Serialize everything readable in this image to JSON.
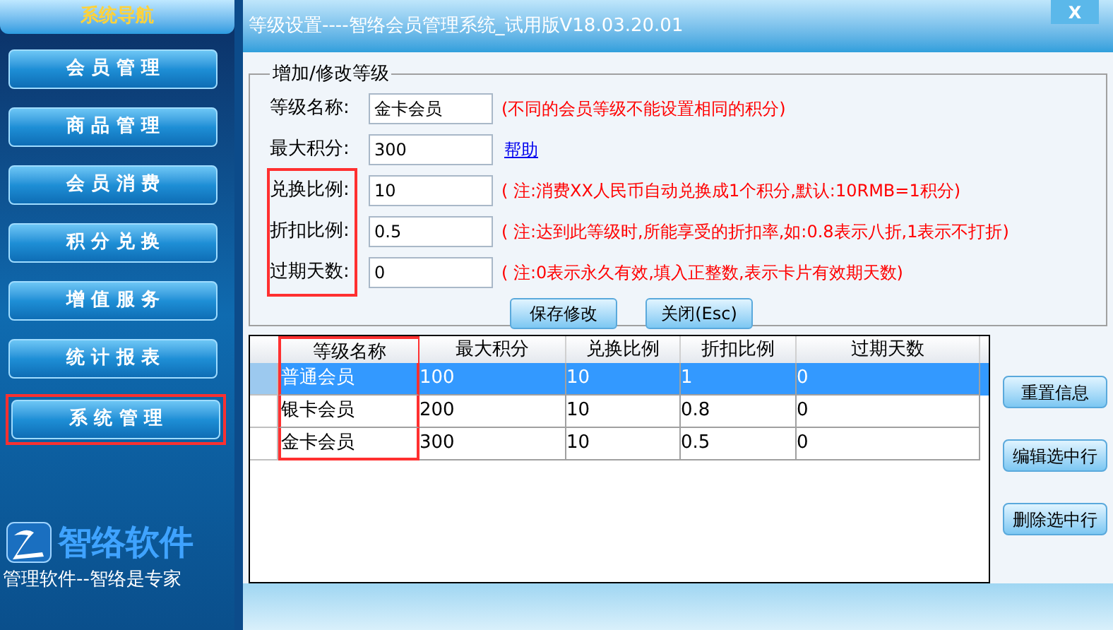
{
  "sidebar": {
    "title": "系统导航",
    "items": [
      {
        "label": "会 员 管 理",
        "highlighted": false
      },
      {
        "label": "商 品 管 理",
        "highlighted": false
      },
      {
        "label": "会 员 消 费",
        "highlighted": false
      },
      {
        "label": "积 分 兑 换",
        "highlighted": false
      },
      {
        "label": "增 值 服 务",
        "highlighted": false
      },
      {
        "label": "统 计 报 表",
        "highlighted": false
      },
      {
        "label": "系 统 管 理",
        "highlighted": true
      }
    ],
    "logo": {
      "name": "智络软件",
      "slogan": "管理软件--智络是专家"
    }
  },
  "window": {
    "title": "等级设置----智络会员管理系统_试用版V18.03.20.01",
    "close": "X"
  },
  "form": {
    "legend": "增加/修改等级",
    "fields": [
      {
        "label": "等级名称:",
        "value": "金卡会员",
        "note": "(不同的会员等级不能设置相同的积分)",
        "kind": "note",
        "highlighted": false
      },
      {
        "label": "最大积分:",
        "value": "300",
        "note": "帮助",
        "kind": "link",
        "highlighted": false
      },
      {
        "label": "兑换比例:",
        "value": "10",
        "note": "( 注:消费XX人民币自动兑换成1个积分,默认:10RMB=1积分)",
        "kind": "note",
        "highlighted": true
      },
      {
        "label": "折扣比例:",
        "value": "0.5",
        "note": "( 注:达到此等级时,所能享受的折扣率,如:0.8表示八折,1表示不打折)",
        "kind": "note",
        "highlighted": true
      },
      {
        "label": "过期天数:",
        "value": "0",
        "note": "( 注:0表示永久有效,填入正整数,表示卡片有效期天数)",
        "kind": "note",
        "highlighted": true
      }
    ],
    "buttons": [
      "保存修改",
      "关闭(Esc)"
    ]
  },
  "table": {
    "columns": [
      {
        "label": "等级名称",
        "highlighted": true
      },
      {
        "label": "最大积分",
        "highlighted": false
      },
      {
        "label": "兑换比例",
        "highlighted": false
      },
      {
        "label": "折扣比例",
        "highlighted": false
      },
      {
        "label": "过期天数",
        "highlighted": false
      }
    ],
    "rows": [
      {
        "cells": [
          "普通会员",
          "100",
          "10",
          "1",
          "0"
        ],
        "selected": true
      },
      {
        "cells": [
          "银卡会员",
          "200",
          "10",
          "0.8",
          "0"
        ],
        "selected": false
      },
      {
        "cells": [
          "金卡会员",
          "300",
          "10",
          "0.5",
          "0"
        ],
        "selected": false
      }
    ]
  },
  "side_buttons": [
    "重置信息",
    "编辑选中行",
    "删除选中行"
  ]
}
